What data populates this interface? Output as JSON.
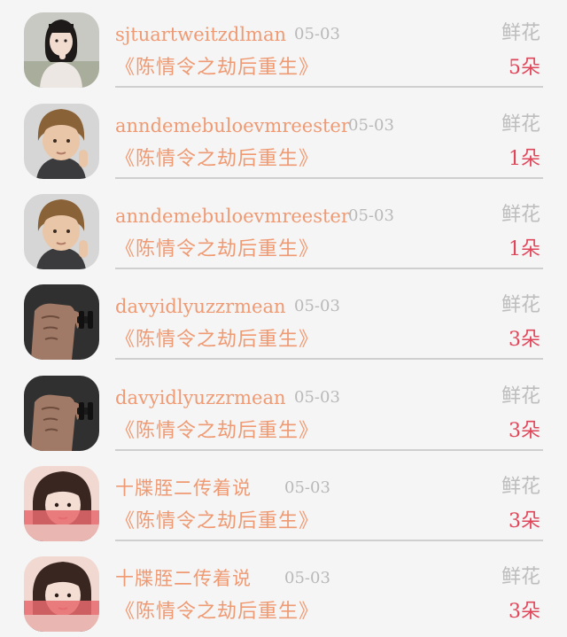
{
  "gift_entries": [
    {
      "username": "sjtuartweitzdlman",
      "date": "05-03",
      "gift_type": "鲜花",
      "book_title": "《陈情令之劫后重生》",
      "gift_count": "5朵",
      "avatar": "girl-portrait"
    },
    {
      "username": "anndemebuloevmreester",
      "date": "05-03",
      "gift_type": "鲜花",
      "book_title": "《陈情令之劫后重生》",
      "gift_count": "1朵",
      "avatar": "child-portrait"
    },
    {
      "username": "anndemebuloevmreester",
      "date": "05-03",
      "gift_type": "鲜花",
      "book_title": "《陈情令之劫后重生》",
      "gift_count": "1朵",
      "avatar": "child-portrait"
    },
    {
      "username": "davyidlyuzzrmean",
      "date": "05-03",
      "gift_type": "鲜花",
      "book_title": "《陈情令之劫后重生》",
      "gift_count": "3朵",
      "avatar": "bodybuilder-dumbbell"
    },
    {
      "username": "davyidlyuzzrmean",
      "date": "05-03",
      "gift_type": "鲜花",
      "book_title": "《陈情令之劫后重生》",
      "gift_count": "3朵",
      "avatar": "bodybuilder-dumbbell"
    },
    {
      "username": "十牒胵二传着说",
      "date": "05-03",
      "gift_type": "鲜花",
      "book_title": "《陈情令之劫后重生》",
      "gift_count": "3朵",
      "avatar": "girl-selfie"
    },
    {
      "username": "十牒胵二传着说",
      "date": "05-03",
      "gift_type": "鲜花",
      "book_title": "《陈情令之劫后重生》",
      "gift_count": "3朵",
      "avatar": "girl-selfie"
    }
  ],
  "colors": {
    "accent": "#ef9a73",
    "count": "#e0465a",
    "muted": "#b9b9b9",
    "background": "#f5f5f5"
  }
}
